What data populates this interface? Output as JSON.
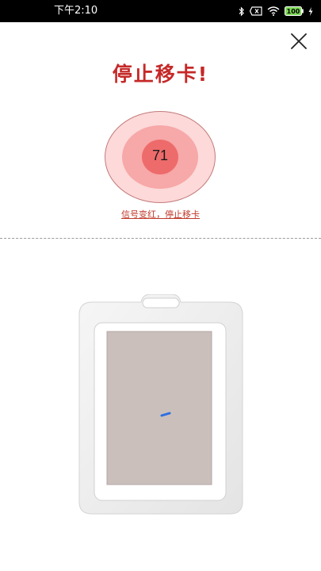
{
  "status_bar": {
    "time": "下午2:10",
    "battery": "100",
    "icons": [
      "bluetooth-icon",
      "sim-x-icon",
      "wifi-icon",
      "battery-icon",
      "charging-icon"
    ]
  },
  "header": {
    "title": "停止移卡!",
    "close_icon": "close-icon"
  },
  "signal": {
    "value": "71",
    "hint": "信号变红，停止移卡",
    "colors": {
      "outer": "#fdd9d9",
      "mid": "#f7a8a8",
      "inner": "#ee6b6b"
    }
  },
  "colors": {
    "title": "#c62828",
    "hint": "#c0392b",
    "status_bar": "#000000"
  }
}
